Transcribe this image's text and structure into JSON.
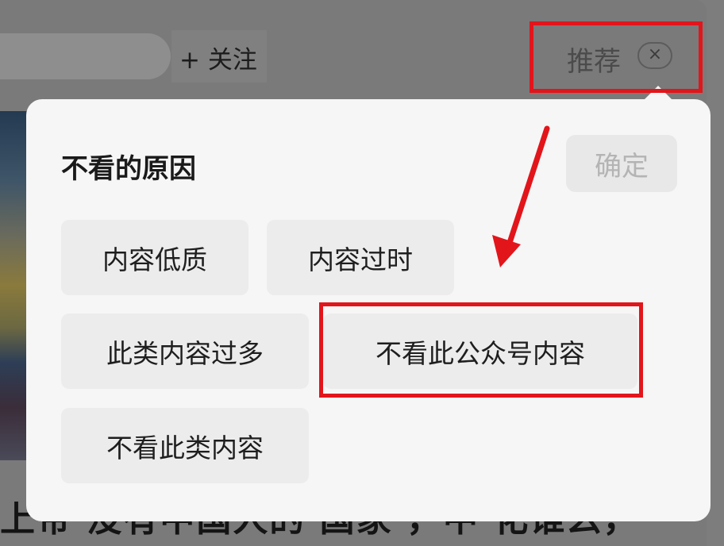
{
  "background": {
    "follow_label": "+ 关注",
    "recommend_label": "推荐",
    "close_glyph": "×",
    "article_text": "上帝 没有中国人的 国家 ，中 化谁么，"
  },
  "popup": {
    "title": "不看的原因",
    "confirm_label": "确定",
    "reasons": [
      {
        "label": "内容低质"
      },
      {
        "label": "内容过时"
      },
      {
        "label": "此类内容过多"
      },
      {
        "label": "不看此公众号内容"
      },
      {
        "label": "不看此类内容"
      }
    ]
  },
  "annotations": {
    "highlight_color": "#e2151b",
    "arrow_color": "#e2151b"
  }
}
